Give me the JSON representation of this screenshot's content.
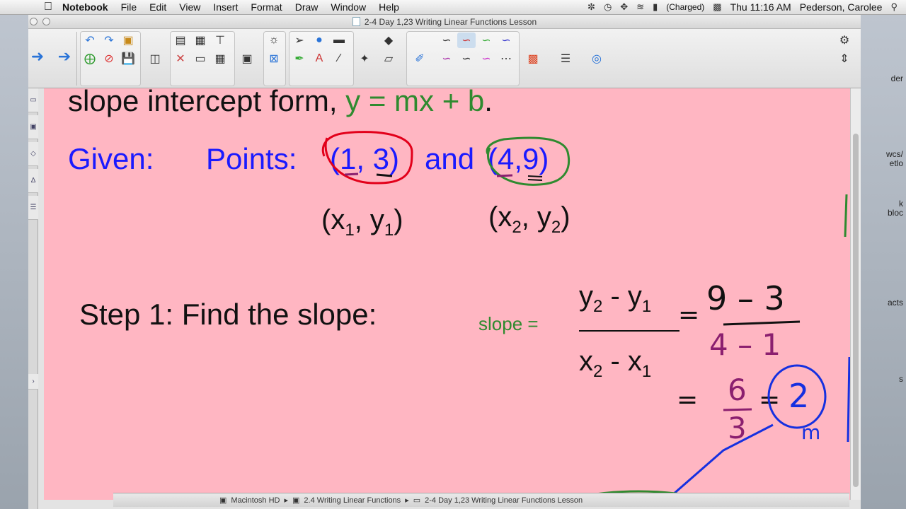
{
  "menubar": {
    "app_name": "Notebook",
    "menus": [
      "File",
      "Edit",
      "View",
      "Insert",
      "Format",
      "Draw",
      "Window",
      "Help"
    ],
    "battery": "(Charged)",
    "clock": "Thu 11:16 AM",
    "user": "Pederson, Carolee"
  },
  "window": {
    "title": "2-4 Day 1,23  Writing Linear Functions Lesson"
  },
  "desktop_labels": [
    "der",
    "wcs/",
    "etlo",
    "k",
    "bloc",
    "acts",
    "s"
  ],
  "slide": {
    "heading_prefix": "slope intercept form, ",
    "heading_formula": "y = mx + b",
    "heading_period": ".",
    "given_label": "Given:",
    "points_label": "Points:",
    "point1": "(1, 3)",
    "and_label": "and",
    "point2": "(4,9)",
    "p1_label_x": "(x",
    "p1_sub1": "1",
    "p1_label_mid": ", y",
    "p1_sub2": "1",
    "p1_label_end": ")",
    "p2_label_x": "(x",
    "p2_sub1": "2",
    "p2_label_mid": ", y",
    "p2_sub2": "2",
    "p2_label_end": ")",
    "step1": "Step 1: Find the slope:",
    "slope_label": "slope =",
    "num_y": "y",
    "num_sub2": "2",
    "num_minus": " - y",
    "num_sub1": "1",
    "den_x": "x",
    "den_sub2": "2",
    "den_minus": " - x",
    "den_sub1": "1",
    "hand_eq1": "=",
    "hand_num": "9 – 3",
    "hand_den": "4 – 1",
    "hand_eq2": "=",
    "hand_frac_num": "6",
    "hand_frac_den": "3",
    "hand_eq3": "=",
    "hand_result": "2",
    "hand_initials": "m"
  },
  "pathbar": {
    "items": [
      "Macintosh HD",
      "2.4 Writing Linear Functions",
      "2-4 Day 1,23  Writing Linear Functions Lesson"
    ]
  },
  "colors": {
    "page_bg": "#ffb6c2",
    "blue_text": "#1a1aff",
    "green_text": "#2f8a2f",
    "red_ink": "#e2001a",
    "green_ink": "#2f8a2f",
    "purple_ink": "#8b1f6f",
    "blue_ink": "#1530e0"
  }
}
